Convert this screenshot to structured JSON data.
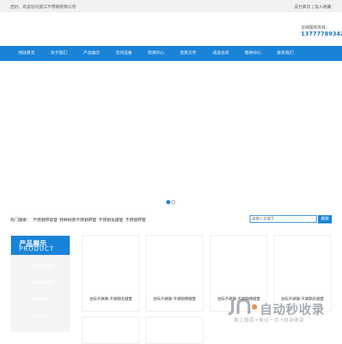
{
  "topbar": {
    "welcome": "您好，欢迎访问浙江不锈钢有限公司",
    "set_home": "设为首页",
    "separator": " | ",
    "add_favorite": "加入收藏"
  },
  "header": {
    "hotline_label": "全国服务热线：",
    "hotline_number": "13777789342"
  },
  "nav": {
    "items": [
      "网站首页",
      "关于我们",
      "产品展示",
      "车间设备",
      "检测中心",
      "资质文件",
      "成品仓库",
      "新闻中心",
      "联系我们"
    ]
  },
  "banner": {
    "active_slide": 1,
    "slide_count": 2
  },
  "hot_search": {
    "label": "热门搜索：",
    "keywords": [
      "不锈钢焊接管",
      "特种材质不锈钢焊管",
      "不锈钢无缝管",
      "不锈钢焊管"
    ]
  },
  "search": {
    "placeholder": "请输入关键字",
    "button": "搜索"
  },
  "sidebar": {
    "title_cn": "产品展示",
    "title_en": "PRODUCT",
    "items": [
      "不锈钢无缝管",
      "不锈钢焊接管",
      "特种材质",
      "不锈钢管"
    ]
  },
  "products": [
    {
      "name": "吉际不锈钢-不锈钢无缝管"
    },
    {
      "name": "吉际不锈钢-不锈钢焊缝管"
    },
    {
      "name": "吉际不锈钢-不锈钢焊缝管"
    },
    {
      "name": "吉际不锈钢-不锈钢无缝管"
    }
  ],
  "watermark": {
    "title": "自动秒收录",
    "subtitle": "数上链接→来访一次→自动收录"
  },
  "colors": {
    "brand_blue": "#1983d8",
    "topbar_bg": "#f1f1f1",
    "sidebar_bg": "#f4f4f4"
  }
}
